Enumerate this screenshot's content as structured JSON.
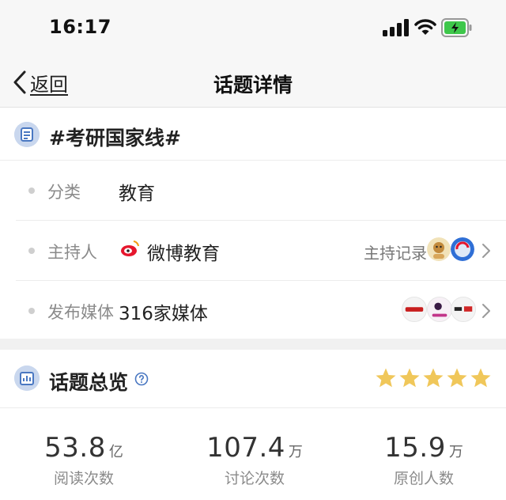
{
  "status_bar": {
    "time": "16:17"
  },
  "nav": {
    "back_label": "返回",
    "title": "话题详情"
  },
  "topic": {
    "title": "#考研国家线#"
  },
  "info_rows": {
    "category": {
      "label": "分类",
      "value": "教育"
    },
    "host": {
      "label": "主持人",
      "value": "微博教育",
      "record_label": "主持记录"
    },
    "media": {
      "label": "发布媒体",
      "value": "316家媒体"
    }
  },
  "overview": {
    "title": "话题总览",
    "rating_stars": 5,
    "star_color": "#f0c75a",
    "stats": [
      {
        "value": "53.8",
        "unit": "亿",
        "label": "阅读次数"
      },
      {
        "value": "107.4",
        "unit": "万",
        "label": "讨论次数"
      },
      {
        "value": "15.9",
        "unit": "万",
        "label": "原创人数"
      }
    ]
  },
  "icons": {
    "topic_icon": "document-list-icon",
    "overview_icon": "bar-chart-icon",
    "help_icon": "question-circle-icon",
    "back_icon": "chevron-left-icon"
  },
  "colors": {
    "icon_bg": "#c9d7ee",
    "icon_fg": "#4a78c2",
    "weibo_red": "#e6162d"
  }
}
